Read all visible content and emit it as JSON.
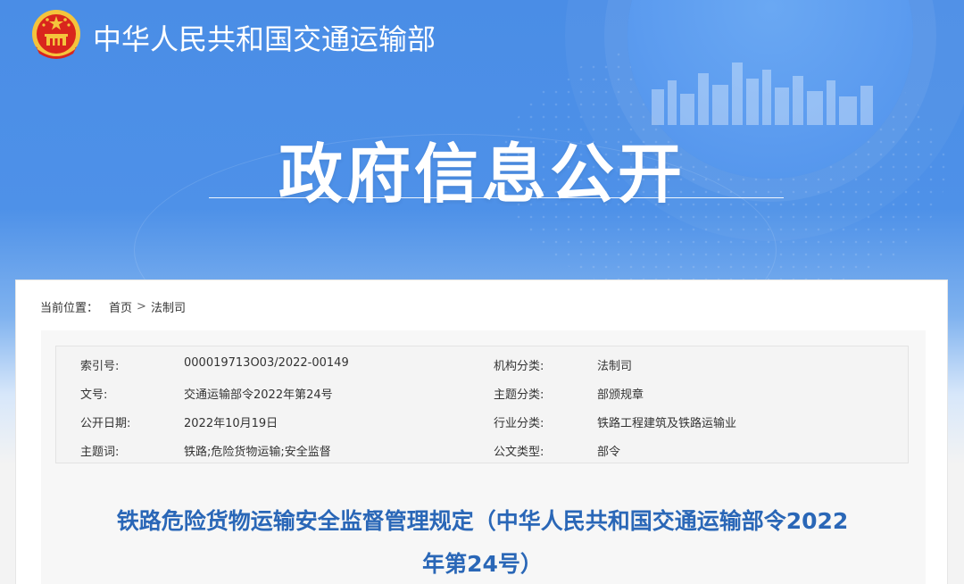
{
  "header": {
    "site_title": "中华人民共和国交通运输部"
  },
  "hero": {
    "title": "政府信息公开"
  },
  "breadcrumb": {
    "prefix": "当前位置：",
    "home": "首页",
    "separator": ">",
    "current": "法制司"
  },
  "meta": {
    "rows": [
      {
        "k1": "索引号:",
        "v1": "000019713O03/2022-00149",
        "k2": "机构分类:",
        "v2": "法制司"
      },
      {
        "k1": "文号:",
        "v1": "交通运输部令2022年第24号",
        "k2": "主题分类:",
        "v2": "部颁规章"
      },
      {
        "k1": "公开日期:",
        "v1": "2022年10月19日",
        "k2": "行业分类:",
        "v2": "铁路工程建筑及铁路运输业"
      },
      {
        "k1": "主题词:",
        "v1": "铁路;危险货物运输;安全监督",
        "k2": "公文类型:",
        "v2": "部令"
      }
    ]
  },
  "document": {
    "title_line1": "铁路危险货物运输安全监督管理规定（中华人民共和国交通运输部令2022",
    "title_line2": "年第24号）"
  },
  "colors": {
    "banner_blue": "#4a8de6",
    "title_blue": "#2a67b7"
  }
}
